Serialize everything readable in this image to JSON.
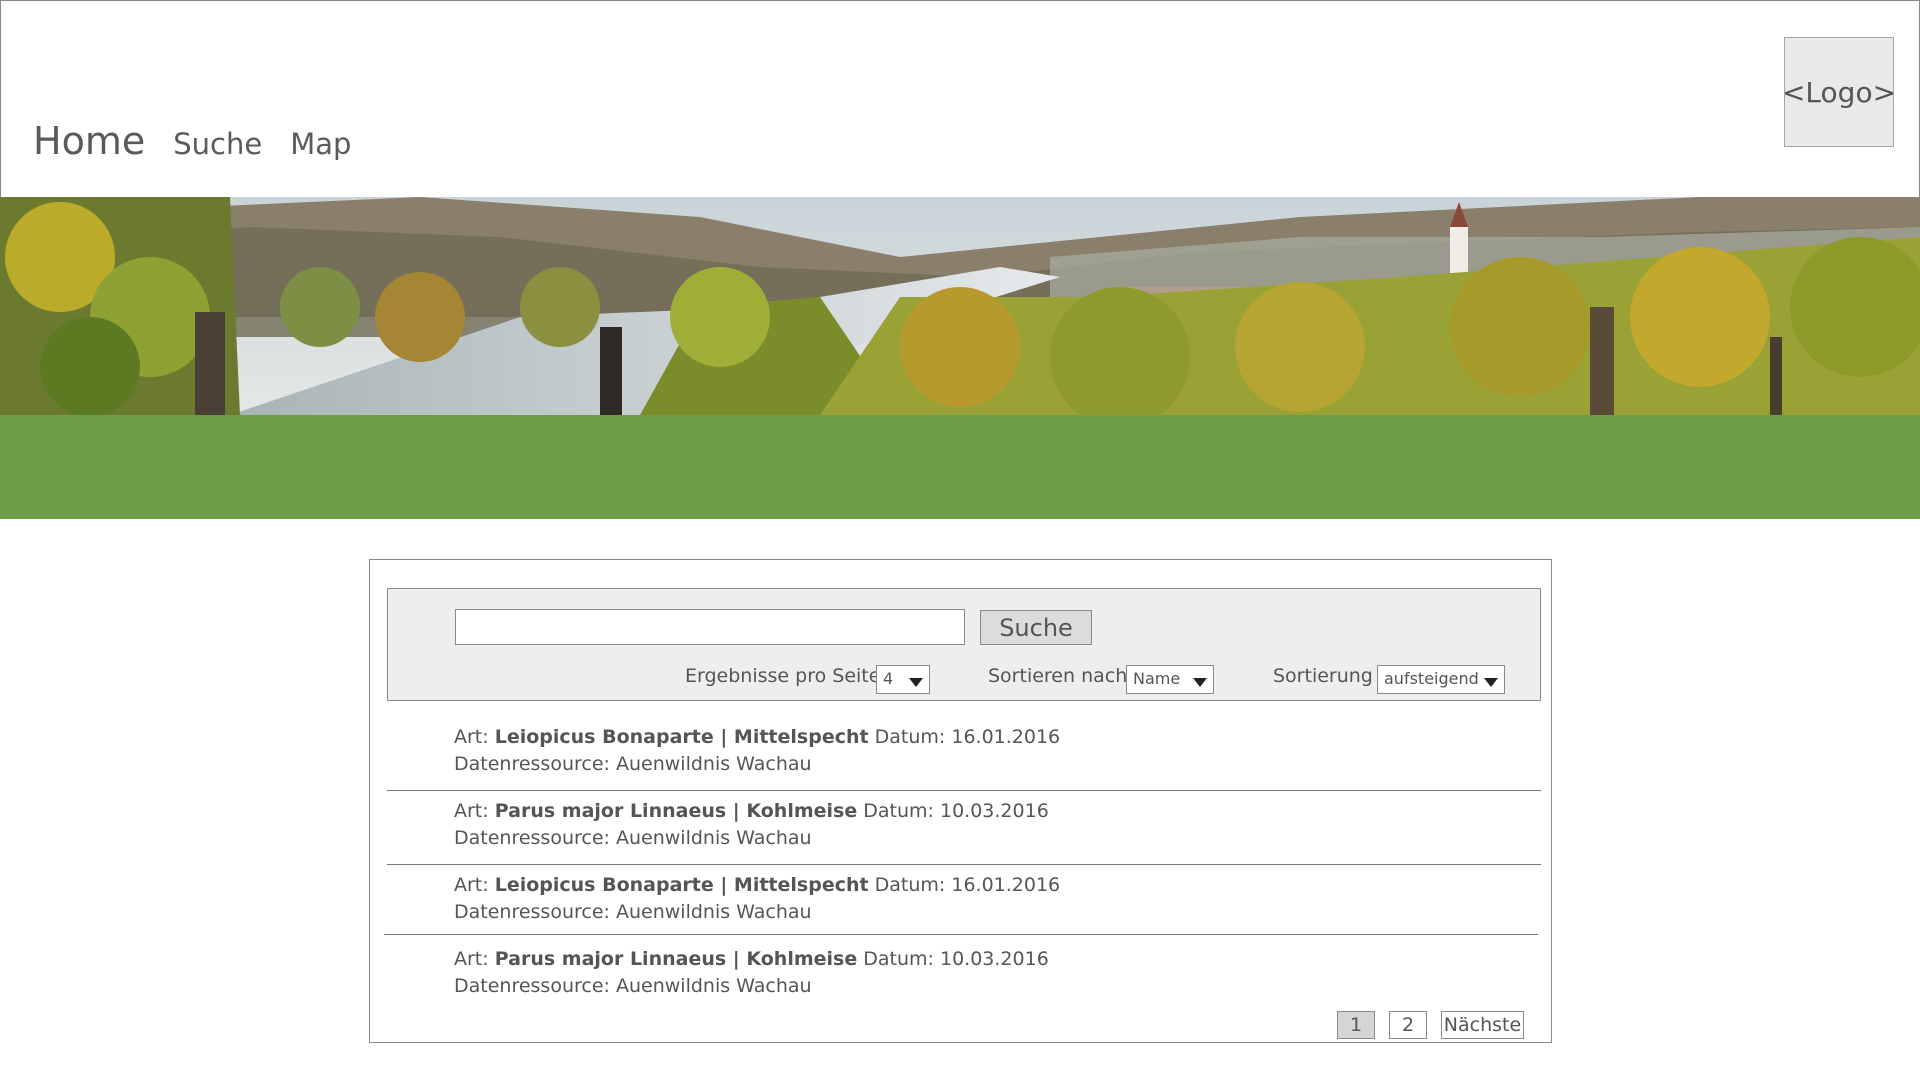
{
  "nav": {
    "home": "Home",
    "search": "Suche",
    "map": "Map"
  },
  "logo": "<Logo>",
  "colors": {
    "accent_green": "#6c9e48",
    "panel_gray": "#eeeeee"
  },
  "search": {
    "value": "",
    "placeholder": "",
    "button_label": "Suche"
  },
  "controls": {
    "per_page_label": "Ergebnisse pro Seite",
    "per_page_value": "4",
    "sort_by_label": "Sortieren nach",
    "sort_by_value": "Name",
    "order_label": "Sortierung",
    "order_value": "aufsteigend"
  },
  "results": [
    {
      "art_label": "Art:",
      "scientific": "Leiopicus Bonaparte",
      "sep": " | ",
      "common": "Mittelspecht",
      "date_label": "Datum:",
      "date": "16.01.2016",
      "source_label": "Datenressource:",
      "source": "Auenwildnis Wachau"
    },
    {
      "art_label": "Art:",
      "scientific": "Parus major Linnaeus",
      "sep": " | ",
      "common": "Kohlmeise",
      "date_label": "Datum:",
      "date": "10.03.2016",
      "source_label": "Datenressource:",
      "source": "Auenwildnis Wachau"
    },
    {
      "art_label": "Art:",
      "scientific": "Leiopicus Bonaparte",
      "sep": " | ",
      "common": "Mittelspecht",
      "date_label": "Datum:",
      "date": "16.01.2016",
      "source_label": "Datenressource:",
      "source": "Auenwildnis Wachau"
    },
    {
      "art_label": "Art:",
      "scientific": "Parus major Linnaeus",
      "sep": " | ",
      "common": "Kohlmeise",
      "date_label": "Datum:",
      "date": "10.03.2016",
      "source_label": "Datenressource:",
      "source": "Auenwildnis Wachau"
    }
  ],
  "pagination": {
    "page1": "1",
    "page2": "2",
    "next": "Nächste",
    "current": 1
  }
}
